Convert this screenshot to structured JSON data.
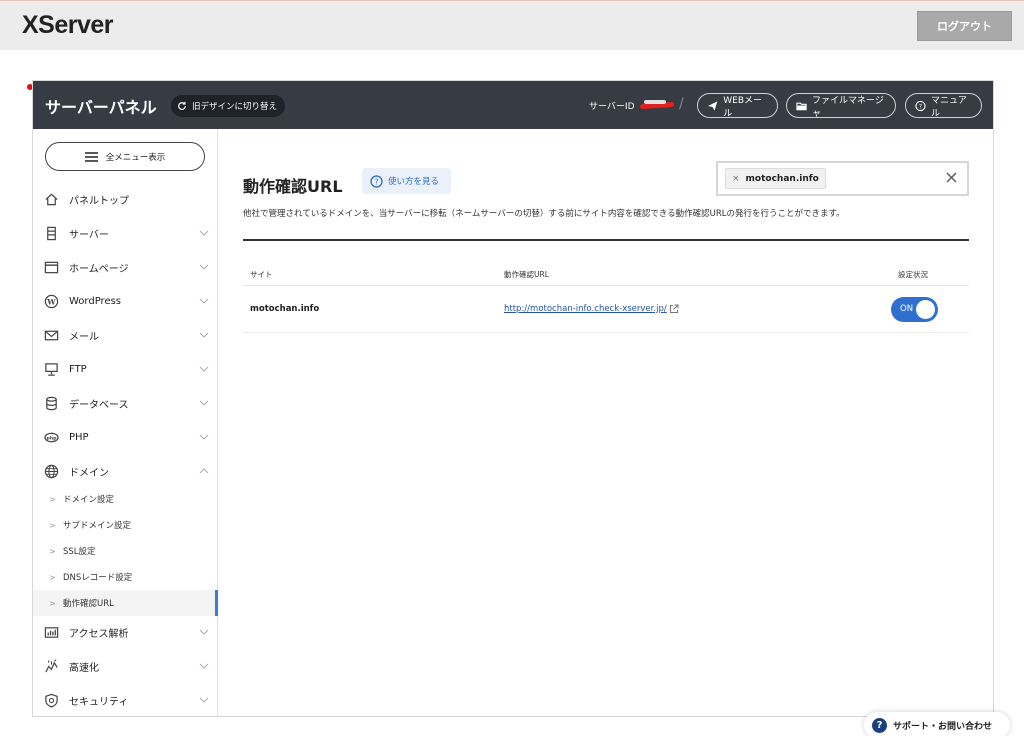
{
  "header": {
    "logo": "XServer",
    "logout_label": "ログアウト"
  },
  "panel": {
    "title": "サーバーパネル",
    "old_design_label": "旧デザインに切り替え",
    "server_id_label": "サーバーID",
    "slash": "/",
    "webmail_label": "WEBメール",
    "file_manager_label": "ファイルマネージャ",
    "manual_label": "マニュアル"
  },
  "sidebar": {
    "all_menu_label": "全メニュー表示",
    "items": [
      {
        "label": "パネルトップ",
        "icon": "home-icon"
      },
      {
        "label": "サーバー",
        "icon": "server-icon"
      },
      {
        "label": "ホームページ",
        "icon": "browser-icon"
      },
      {
        "label": "WordPress",
        "icon": "wordpress-icon"
      },
      {
        "label": "メール",
        "icon": "mail-icon"
      },
      {
        "label": "FTP",
        "icon": "monitor-icon"
      },
      {
        "label": "データベース",
        "icon": "database-icon"
      },
      {
        "label": "PHP",
        "icon": "php-icon"
      },
      {
        "label": "ドメイン",
        "icon": "globe-icon"
      }
    ],
    "sub_items": [
      {
        "label": "ドメイン設定"
      },
      {
        "label": "サブドメイン設定"
      },
      {
        "label": "SSL設定"
      },
      {
        "label": "DNSレコード設定"
      },
      {
        "label": "動作確認URL"
      }
    ],
    "bottom_items": [
      {
        "label": "アクセス解析",
        "icon": "bar-chart-icon"
      },
      {
        "label": "高速化",
        "icon": "speed-icon"
      },
      {
        "label": "セキュリティ",
        "icon": "shield-icon"
      }
    ]
  },
  "main": {
    "title": "動作確認URL",
    "howto_label": "使い方を見る",
    "search_tag": "motochan.info",
    "description": "他社で管理されているドメインを、当サーバーに移転（ネームサーバーの切替）する前にサイト内容を確認できる動作確認URLの発行を行うことができます。",
    "table": {
      "headers": [
        "サイト",
        "動作確認URL",
        "設定状況"
      ],
      "rows": [
        {
          "site": "motochan.info",
          "url": "http://motochan-info.check-xserver.jp/",
          "status": "ON"
        }
      ]
    }
  },
  "support_label": "サポート・お問い合わせ",
  "colors": {
    "panel_bar": "#363b44",
    "accent": "#2f6fcf",
    "active_marker": "#3a7bd5"
  }
}
